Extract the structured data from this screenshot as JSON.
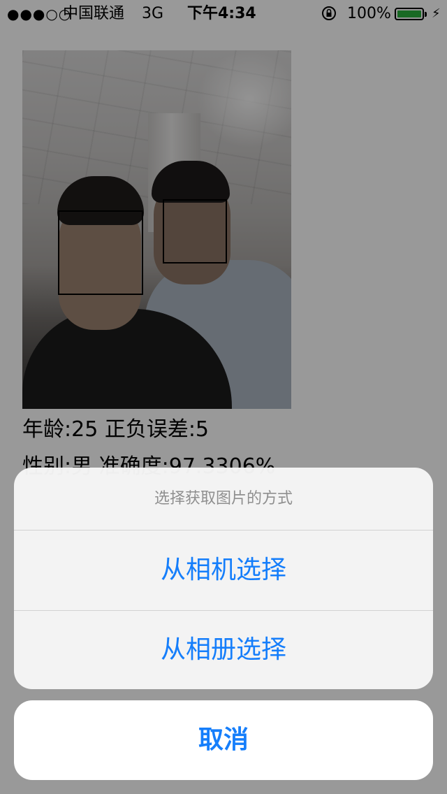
{
  "status_bar": {
    "signal": "●●●○○",
    "carrier": "中国联通",
    "network": "3G",
    "time": "下午4:34",
    "battery_percent": "100%",
    "battery_level": 1.0,
    "battery_color": "#2bb03c",
    "icons": [
      "orientation-lock-icon",
      "battery-icon",
      "charging-bolt-icon"
    ]
  },
  "result": {
    "line1": "年龄:25  正负误差:5",
    "line2": "性别:男  准确度:97.3306%"
  },
  "action_sheet": {
    "title": "选择获取图片的方式",
    "options": [
      {
        "label": "从相机选择"
      },
      {
        "label": "从相册选择"
      }
    ],
    "cancel_label": "取消"
  },
  "colors": {
    "accent": "#157efb",
    "title_gray": "#8f8f8f",
    "overlay": "rgba(0,0,0,0.4)"
  }
}
